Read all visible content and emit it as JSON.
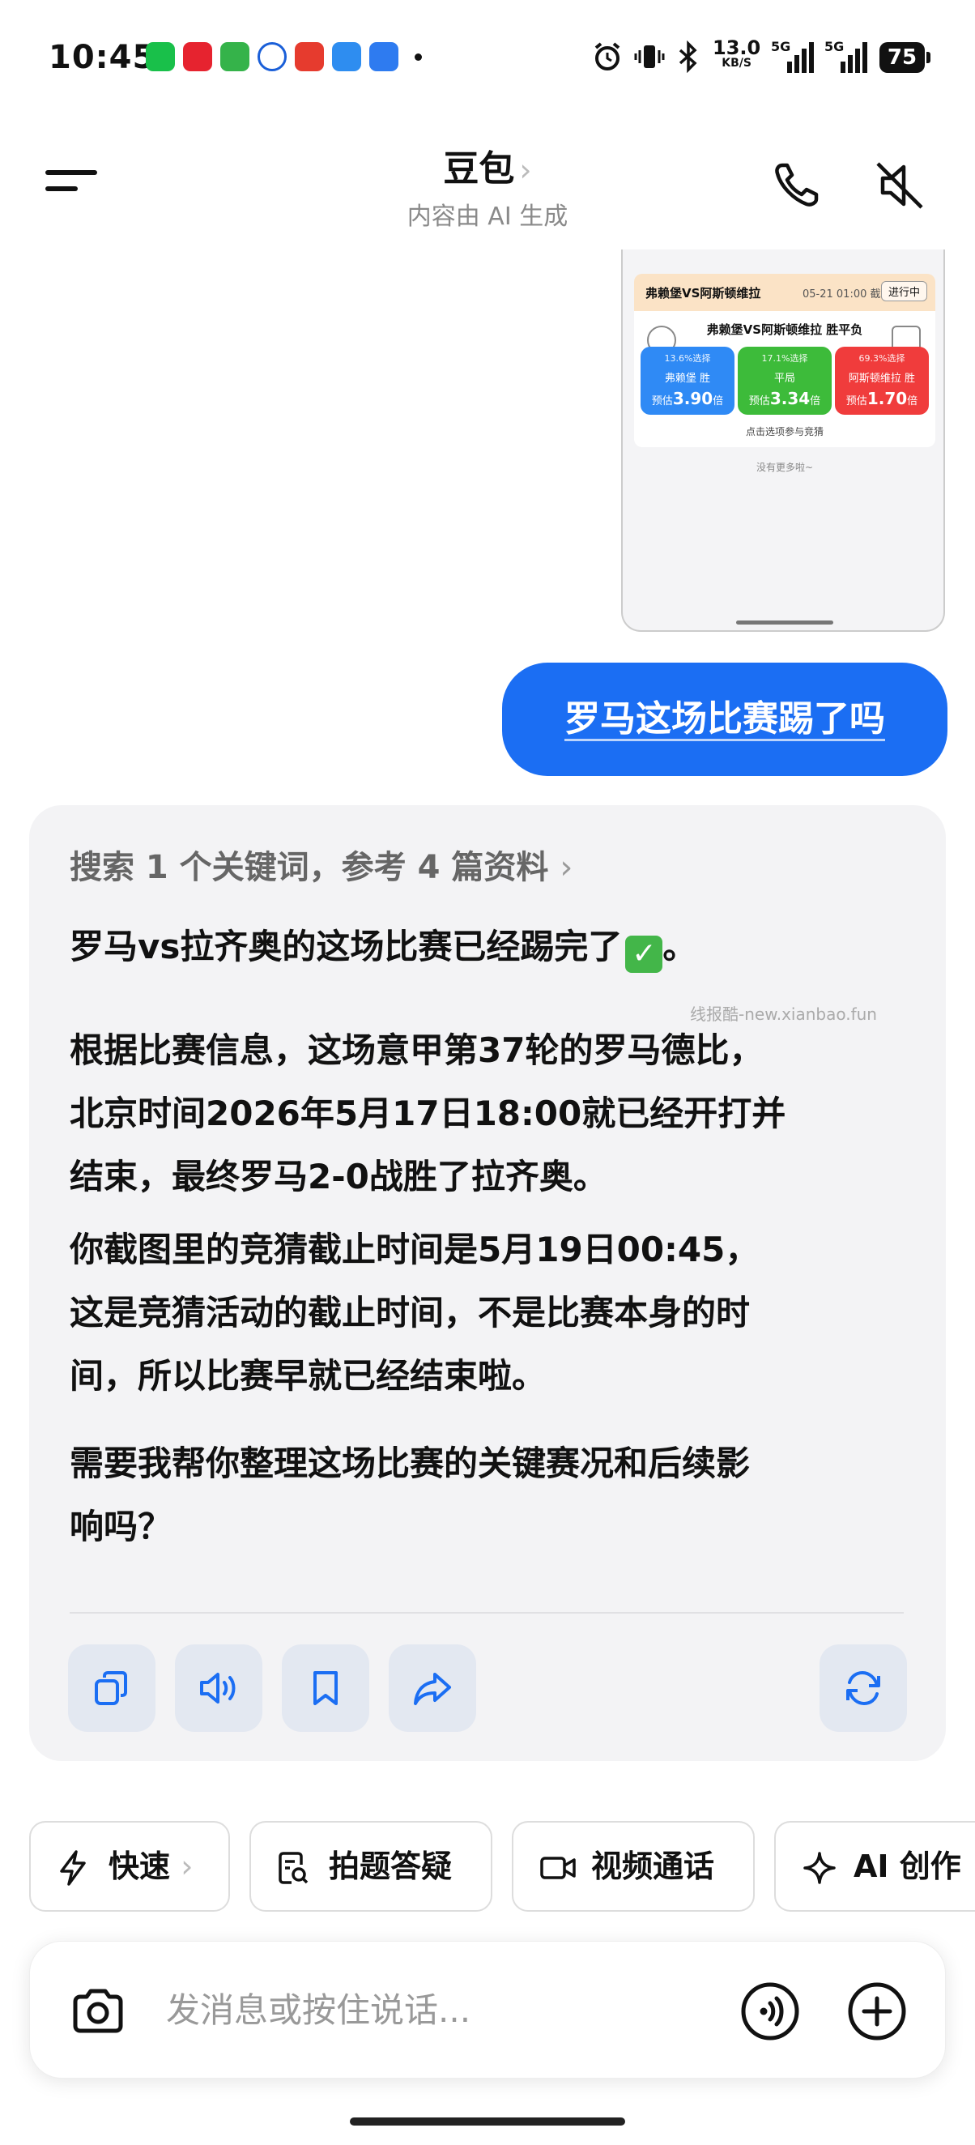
{
  "status_bar": {
    "time": "10:45",
    "net_speed": "13.0",
    "net_unit": "KB/S",
    "signal_1": "5G",
    "signal_2": "5G",
    "battery": "75",
    "notification_colors": [
      "#19c04a",
      "#e6232f",
      "#35b34a",
      "#1a5fd8",
      "#e63b2e",
      "#2e8df0",
      "#2e7bf0"
    ]
  },
  "header": {
    "title": "豆包",
    "title_chevron": "›",
    "subtitle": "内容由 AI 生成"
  },
  "attached_screenshot": {
    "match_title": "弗赖堡VS阿斯顿维拉",
    "deadline": "05-21 01:00 截止",
    "status": "进行中",
    "question": "弗赖堡VS阿斯顿维拉 胜平负",
    "options": [
      {
        "pct": "13.6%选择",
        "name": "弗赖堡 胜",
        "odds_prefix": "预估",
        "odds": "3.90",
        "odds_suffix": "倍",
        "color": "#2f8af5"
      },
      {
        "pct": "17.1%选择",
        "name": "平局",
        "odds_prefix": "预估",
        "odds": "3.34",
        "odds_suffix": "倍",
        "color": "#3dbb3a"
      },
      {
        "pct": "69.3%选择",
        "name": "阿斯顿维拉 胜",
        "odds_prefix": "预估",
        "odds": "1.70",
        "odds_suffix": "倍",
        "color": "#f03c3c"
      }
    ],
    "hint": "点击选项参与竞猜",
    "more": "没有更多啦~"
  },
  "user_message": "罗马这场比赛踢了吗",
  "ai_message": {
    "search_ref": "搜索 1 个关键词，参考 4 篇资料",
    "search_chevron": "›",
    "p1_a": "罗马vs拉齐奥的这场比赛",
    "p1_b": "已经踢完了",
    "p1_check": "✓",
    "p1_c": "。",
    "watermark": "线报酷-new.xianbao.fun",
    "p2_l1": "根据比赛信息，这场意甲第37轮的罗马德比，",
    "p2_l2": "北京时间2026年5月17日18:00就已经开打并",
    "p2_l3": "结束，最终罗马2-0战胜了拉齐奥。",
    "p3_l1": "你截图里的竞猜截止时间是5月19日00:45，",
    "p3_l2": "这是竞猜活动的截止时间，不是比赛本身的时",
    "p3_l3": "间，所以比赛早就已经结束啦。",
    "p4_a": "需要我帮你整理这场比赛的",
    "p4_b": "关键赛况和后续影",
    "p4_c": "响",
    "p4_d": "吗？"
  },
  "actions": {
    "copy": "copy-icon",
    "speak": "speaker-icon",
    "bookmark": "bookmark-icon",
    "share": "share-icon",
    "regenerate": "refresh-icon"
  },
  "chips": [
    {
      "label": "快速",
      "chevron": "›"
    },
    {
      "label": "拍题答疑"
    },
    {
      "label": "视频通话"
    },
    {
      "label": "AI 创作"
    }
  ],
  "input": {
    "placeholder": "发消息或按住说话..."
  },
  "accent_color": "#1b6ef3"
}
